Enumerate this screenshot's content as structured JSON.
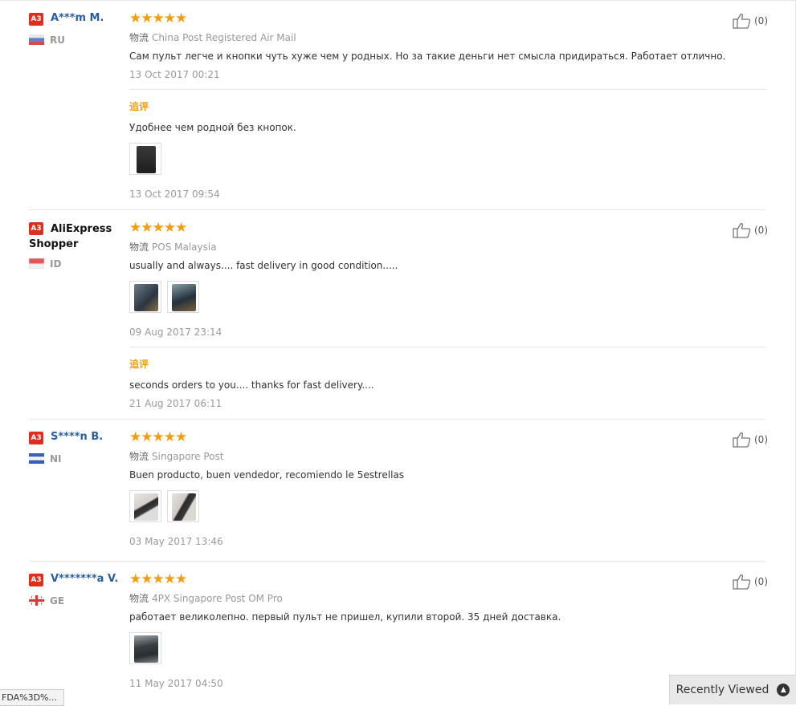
{
  "logistics_label": "物流",
  "additional_feedback_label": "追评",
  "reviews": [
    {
      "level": "A3",
      "name": "A***m M.",
      "country": "RU",
      "stars": "★★★★★",
      "logistics": "China Post Registered Air Mail",
      "feedback": "Сам пульт легче и кнопки чуть хуже чем у родных. Но за такие деньги нет смысла придираться. Работает отлично.",
      "date": "13 Oct 2017 00:21",
      "helpful": "(0)",
      "additional": {
        "feedback": "Удобнее чем родной без кнопок.",
        "date": "13 Oct 2017 09:54"
      }
    },
    {
      "level": "A3",
      "name": "AliExpress Shopper",
      "country": "ID",
      "stars": "★★★★★",
      "logistics": "POS Malaysia",
      "feedback": "usually and always.... fast delivery in good condition.....",
      "date": "09 Aug 2017 23:14",
      "helpful": "(0)",
      "additional": {
        "feedback": "seconds orders to you.... thanks for fast delivery....",
        "date": "21 Aug 2017 06:11"
      }
    },
    {
      "level": "A3",
      "name": "S****n B.",
      "country": "NI",
      "stars": "★★★★★",
      "logistics": "Singapore Post",
      "feedback": "Buen producto, buen vendedor, recomiendo le 5estrellas",
      "date": "03 May 2017 13:46",
      "helpful": "(0)"
    },
    {
      "level": "A3",
      "name": "V*******a V.",
      "country": "GE",
      "stars": "★★★★★",
      "logistics": "4PX Singapore Post OM Pro",
      "feedback": "работает великолепно. первый пульт не пришел, купили второй. 35 дней доставка.",
      "date": "11 May 2017 04:50",
      "helpful": "(0)"
    }
  ],
  "status_url": "FDA%3D%...",
  "recently_viewed": "Recently Viewed",
  "colors": {
    "badge": "#e22d1a",
    "stars": "#f39c12",
    "name": "#2a5ea5"
  }
}
